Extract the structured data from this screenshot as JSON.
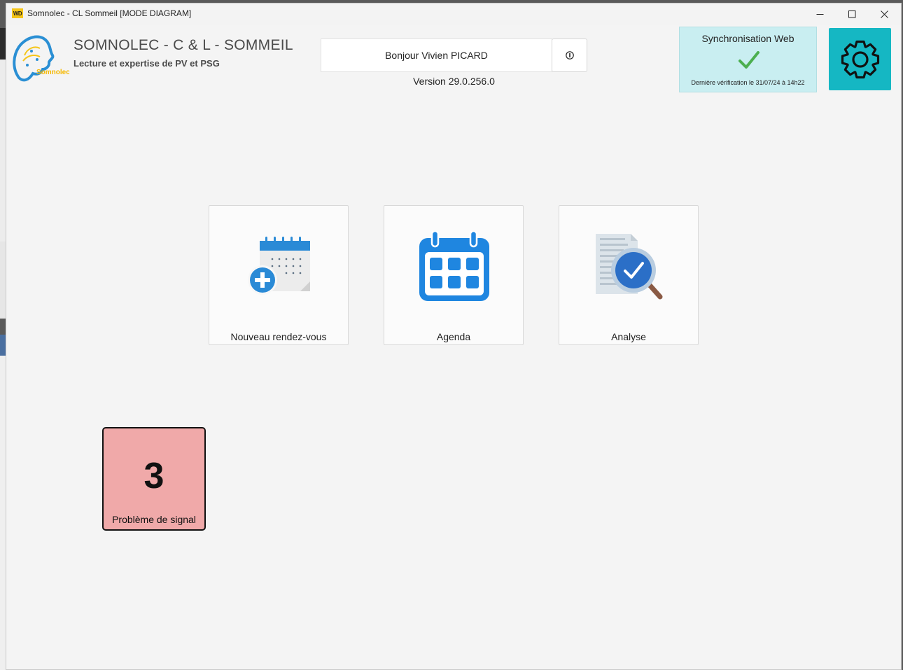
{
  "window": {
    "title": "Somnolec - CL Sommeil [MODE DIAGRAM]",
    "logo_text": "WD"
  },
  "header": {
    "app_title": "SOMNOLEC - C & L - SOMMEIL",
    "app_subtitle": "Lecture et expertise de PV et PSG",
    "logo_text": "Somnolec",
    "greeting": "Bonjour Vivien PICARD",
    "version": "Version 29.0.256.0"
  },
  "sync": {
    "title": "Synchronisation Web",
    "last_check": "Dernière vérification le 31/07/24 à 14h22",
    "status_icon": "checkmark-icon",
    "status_color": "#4caf50",
    "panel_color": "#c9eef1"
  },
  "settings": {
    "icon": "gear-icon",
    "color": "#15b7c3"
  },
  "tiles": [
    {
      "label": "Nouveau rendez-vous",
      "icon": "calendar-add-icon"
    },
    {
      "label": "Agenda",
      "icon": "calendar-icon"
    },
    {
      "label": "Analyse",
      "icon": "document-search-icon"
    }
  ],
  "alert": {
    "count": "3",
    "label": "Problème de signal",
    "color": "#f0a9a9"
  }
}
